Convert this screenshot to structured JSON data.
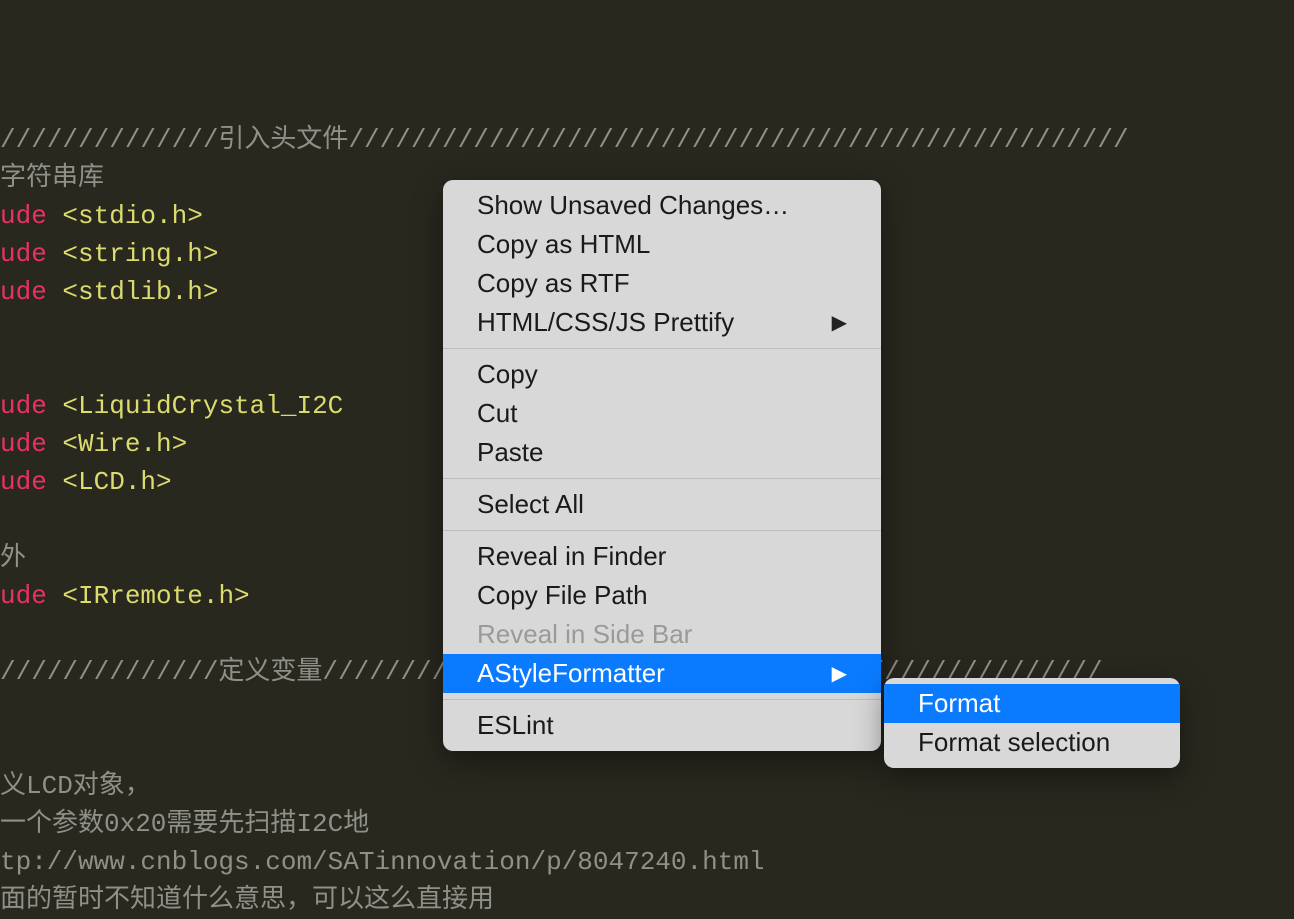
{
  "code": {
    "line1_comment": "//////////////引入头文件//////////////////////////////////////////////////",
    "line2_comment": "字符串库",
    "dir_ude": "ude",
    "inc1": "<stdio.h>",
    "inc2": "<string.h>",
    "inc3": "<stdlib.h>",
    "inc4": "<LiquidCrystal_I2C",
    "inc5": "<Wire.h>",
    "inc6": "<LCD.h>",
    "line_wai": "外",
    "inc7": "<IRremote.h>",
    "line_divider": "//////////////定义变量//////////////////////////////////////////////////",
    "lcd_comment1": "义LCD对象，",
    "lcd_comment2": "一个参数0x20需要先扫描I2C地",
    "url_line": "tp://www.cnblogs.com/SATinnovation/p/8047240.html",
    "last_comment": "面的暂时不知道什么意思，可以这么直接用"
  },
  "context_menu": {
    "items": [
      {
        "label": "Show Unsaved Changes…",
        "submenu": false,
        "disabled": false
      },
      {
        "label": "Copy as HTML",
        "submenu": false,
        "disabled": false
      },
      {
        "label": "Copy as RTF",
        "submenu": false,
        "disabled": false
      },
      {
        "label": "HTML/CSS/JS Prettify",
        "submenu": true,
        "disabled": false
      }
    ],
    "group2": [
      {
        "label": "Copy"
      },
      {
        "label": "Cut"
      },
      {
        "label": "Paste"
      }
    ],
    "group3": [
      {
        "label": "Select All"
      }
    ],
    "group4": [
      {
        "label": "Reveal in Finder",
        "disabled": false
      },
      {
        "label": "Copy File Path",
        "disabled": false
      },
      {
        "label": "Reveal in Side Bar",
        "disabled": true
      },
      {
        "label": "AStyleFormatter",
        "submenu": true,
        "selected": true
      }
    ],
    "group5": [
      {
        "label": "ESLint"
      }
    ]
  },
  "submenu": {
    "items": [
      {
        "label": "Format",
        "selected": true
      },
      {
        "label": "Format selection",
        "selected": false
      }
    ]
  }
}
